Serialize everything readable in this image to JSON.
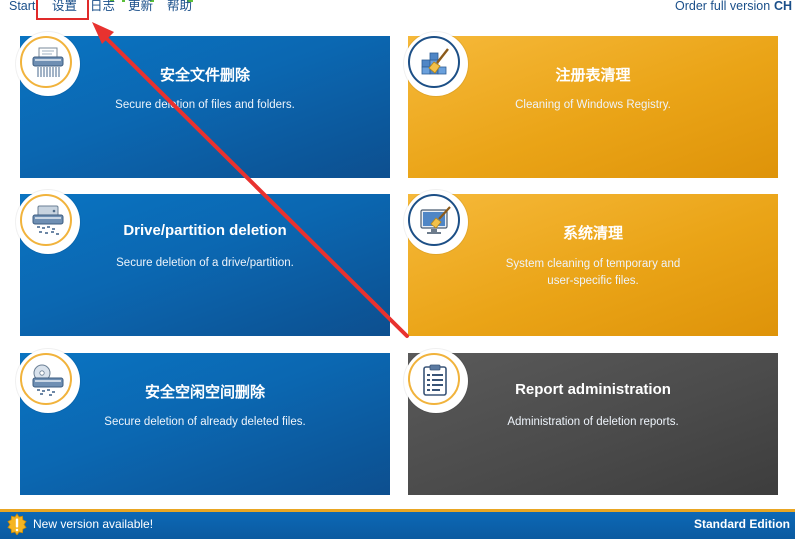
{
  "menu": {
    "start": "Start",
    "settings": "设置",
    "log": "日志",
    "update": "更新",
    "help": "帮助",
    "order": "Order full version",
    "lang": "CH"
  },
  "tiles": [
    {
      "title": "安全文件删除",
      "desc": "Secure deletion of files and folders.",
      "icon": "shredder-icon"
    },
    {
      "title": "注册表清理",
      "desc": "Cleaning of Windows Registry.",
      "icon": "registry-cleaning-icon"
    },
    {
      "title": "Drive/partition deletion",
      "desc": "Secure deletion of a drive/partition.",
      "icon": "drive-shredder-icon"
    },
    {
      "title": "系统清理",
      "desc1": "System cleaning of temporary and",
      "desc2": "user-specific files.",
      "icon": "monitor-cleaning-icon"
    },
    {
      "title": "安全空闲空间删除",
      "desc": "Secure deletion of already deleted files.",
      "icon": "disk-shredder-icon"
    },
    {
      "title": "Report administration",
      "desc": "Administration of deletion reports.",
      "icon": "clipboard-report-icon"
    }
  ],
  "status": {
    "message": "New version available!",
    "edition": "Standard Edition"
  },
  "colors": {
    "blue_tile": "#0b67b1",
    "orange_tile": "#eaa417",
    "gray_tile": "#4b4b4b",
    "annotation_red": "#e02a2a"
  }
}
